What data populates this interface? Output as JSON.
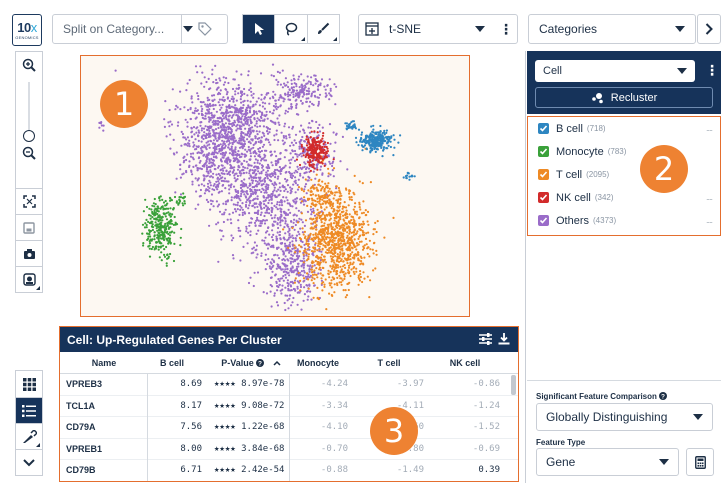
{
  "logo": {
    "text_main": "10",
    "text_x": "x",
    "text_sub": "GENOMICS"
  },
  "toolbar": {
    "split_placeholder": "Split on Category...",
    "projection": "t-SNE",
    "category_select": "Categories"
  },
  "right_panel": {
    "group_select": "Cell",
    "recluster_label": "Recluster",
    "legend": [
      {
        "label": "B cell",
        "count": "(718)",
        "color": "#2e86c1"
      },
      {
        "label": "Monocyte",
        "count": "(783)",
        "color": "#3aa13a"
      },
      {
        "label": "T cell",
        "count": "(2095)",
        "color": "#ee8a25"
      },
      {
        "label": "NK cell",
        "count": "(342)",
        "color": "#d22b2b"
      },
      {
        "label": "Others",
        "count": "(4373)",
        "color": "#9a6cc9"
      }
    ],
    "legend_more": "....",
    "comparison_heading": "Significant Feature Comparison",
    "comparison_value": "Globally Distinguishing",
    "feature_type_heading": "Feature Type",
    "feature_type_value": "Gene"
  },
  "badges": {
    "plot": "1",
    "legend": "2",
    "table": "3"
  },
  "table": {
    "title": "Cell: Up-Regulated Genes Per Cluster",
    "columns": [
      "Name",
      "B cell",
      "P-Value",
      "Monocyte",
      "T cell",
      "NK cell"
    ],
    "rows": [
      {
        "name": "VPREB3",
        "b": "8.69",
        "stars": "★★★★",
        "p": "8.97e-78",
        "mono": "-4.24",
        "t": "-3.97",
        "nk": "-0.86"
      },
      {
        "name": "TCL1A",
        "b": "8.17",
        "stars": "★★★★",
        "p": "9.08e-72",
        "mono": "-3.34",
        "t": "-4.11",
        "nk": "-1.24"
      },
      {
        "name": "CD79A",
        "b": "7.56",
        "stars": "★★★★",
        "p": "1.22e-68",
        "mono": "-4.10",
        "t": "-3.60",
        "nk": "-1.52"
      },
      {
        "name": "VPREB1",
        "b": "8.00",
        "stars": "★★★★",
        "p": "3.84e-68",
        "mono": "-0.70",
        "t": "-0.80",
        "nk": "-0.69"
      },
      {
        "name": "CD79B",
        "b": "6.71",
        "stars": "★★★★",
        "p": "2.42e-54",
        "mono": "-0.88",
        "t": "-1.49",
        "nk": "0.39"
      }
    ]
  }
}
